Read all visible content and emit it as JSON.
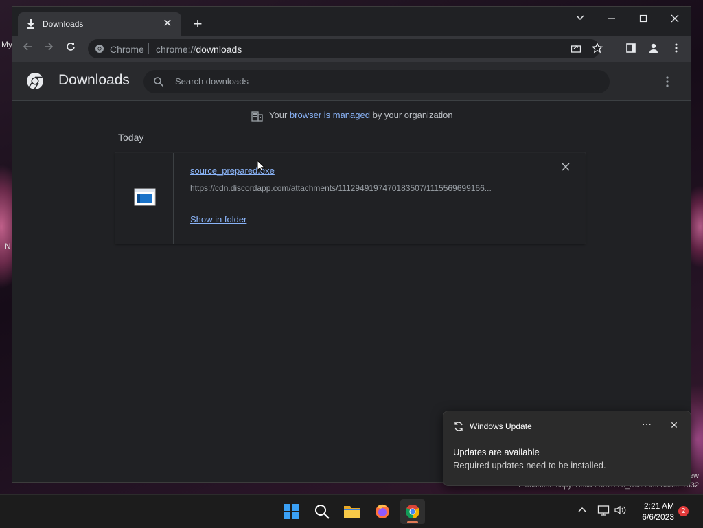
{
  "desktop": {
    "side_text_1": "My",
    "side_text_2": "N",
    "watermark_line1": "ew",
    "watermark_line2": "Evaluation copy. Build 25375.zn_release.2305...-1632"
  },
  "browser": {
    "tab": {
      "title": "Downloads",
      "icon": "download-icon"
    },
    "new_tab_label": "+",
    "window_controls": {
      "dropdown": "⌄",
      "minimize": "–",
      "maximize": "☐",
      "close": "✕"
    },
    "omnibox": {
      "chip": "Chrome",
      "url_scheme": "chrome://",
      "url_host": "downloads"
    }
  },
  "downloads": {
    "title": "Downloads",
    "search_placeholder": "Search downloads",
    "managed_notice": {
      "prefix": "Your ",
      "link": "browser is managed",
      "suffix": " by your organization"
    },
    "date_label": "Today",
    "items": [
      {
        "file_name": "source_prepared.exe",
        "url": "https://cdn.discordapp.com/attachments/1112949197470183507/1115569699166...",
        "action": "Show in folder",
        "icon": "executable-file-icon"
      }
    ]
  },
  "notification": {
    "app": "Windows Update",
    "title": "Updates are available",
    "body": "Required updates need to be installed.",
    "more": "···",
    "close": "✕"
  },
  "taskbar": {
    "apps": [
      "start-icon",
      "search-icon",
      "file-explorer-icon",
      "firefox-icon",
      "chrome-icon"
    ],
    "time": "2:21 AM",
    "date": "6/6/2023",
    "notification_count": "2"
  }
}
